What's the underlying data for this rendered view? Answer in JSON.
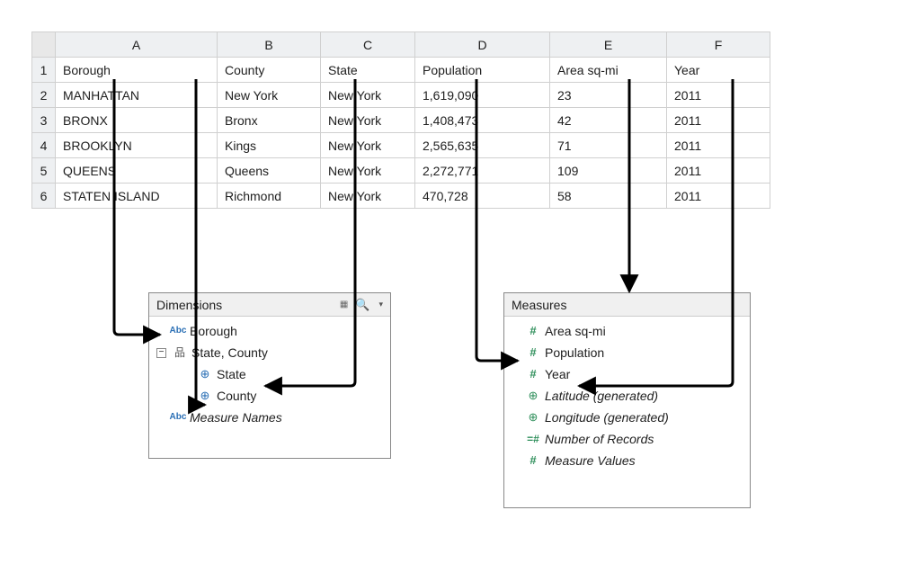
{
  "columns": [
    "A",
    "B",
    "C",
    "D",
    "E",
    "F"
  ],
  "headers": {
    "A": "Borough",
    "B": "County",
    "C": "State",
    "D": "Population",
    "E": "Area sq-mi",
    "F": "Year"
  },
  "rows": [
    {
      "n": "1"
    },
    {
      "n": "2",
      "A": "MANHATTAN",
      "B": "New York",
      "C": "New York",
      "D": "1,619,090",
      "E": "23",
      "F": "2011"
    },
    {
      "n": "3",
      "A": "BRONX",
      "B": "Bronx",
      "C": "New York",
      "D": "1,408,473",
      "E": "42",
      "F": "2011"
    },
    {
      "n": "4",
      "A": "BROOKLYN",
      "B": "Kings",
      "C": "New York",
      "D": "2,565,635",
      "E": "71",
      "F": "2011"
    },
    {
      "n": "5",
      "A": "QUEENS",
      "B": "Queens",
      "C": "New York",
      "D": "2,272,771",
      "E": "109",
      "F": "2011"
    },
    {
      "n": "6",
      "A": "STATEN ISLAND",
      "B": "Richmond",
      "C": "New York",
      "D": "470,728",
      "E": "58",
      "F": "2011"
    }
  ],
  "dimensions": {
    "title": "Dimensions",
    "items": {
      "borough": "Borough",
      "state_county": "State, County",
      "state": "State",
      "county": "County",
      "measure_names": "Measure Names"
    },
    "icons": {
      "abc": "Abc",
      "minus": "−"
    }
  },
  "measures": {
    "title": "Measures",
    "items": {
      "area": "Area sq-mi",
      "population": "Population",
      "year": "Year",
      "latitude": "Latitude (generated)",
      "longitude": "Longitude (generated)",
      "nrec": "Number of Records",
      "mvalues": "Measure Values"
    }
  },
  "glyphs": {
    "hash": "#",
    "eqhash": "=#",
    "globe": "⊕",
    "hier": "品",
    "search": "🔍",
    "list": "▦",
    "tri": "▾"
  }
}
